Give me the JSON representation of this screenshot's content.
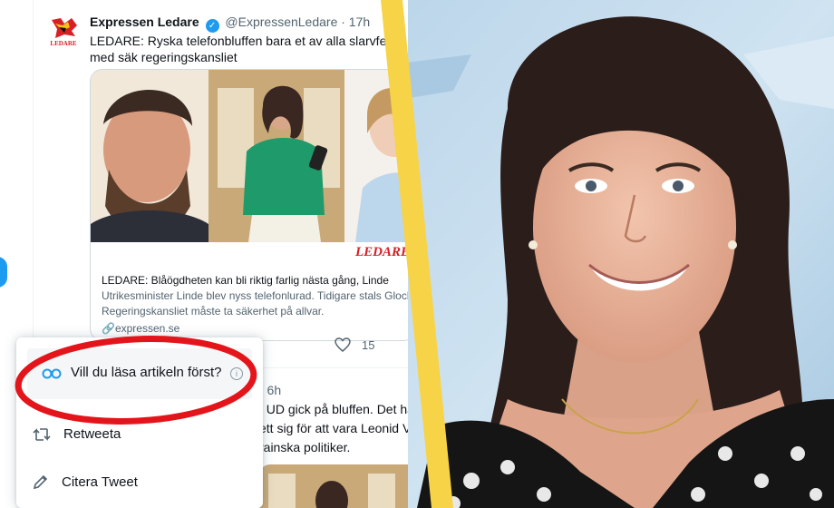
{
  "tweet": {
    "author_name": "Expressen Ledare",
    "handle_time": "@ExpressenLedare · 17h",
    "text": "LEDARE: Ryska telefonbluffen bara et av alla slarvfel med säk regeringskansliet",
    "verified_mark": "✓",
    "card": {
      "watermark": "LEDARE",
      "title": "LEDARE: Blåögdheten kan bli riktig farlig nästa gång, Linde",
      "description_line1": "Utrikesminister Linde blev nyss telefonlurad. Tidigare stals Glockp",
      "description_line2": "Regeringskansliet måste ta säkerhet på allvar.",
      "domain": "expressen.se"
    },
    "like_count": "15"
  },
  "tweet2": {
    "time": "· 6h",
    "line1": "t UD gick på bluffen. Det ha",
    "line2": "ett sig för att vara Leonid Vo",
    "line3": "rainska politiker."
  },
  "menu": {
    "read_first": "Vill du läsa artikeln först?",
    "retweet": "Retweeta",
    "quote": "Citera Tweet",
    "info_glyph": "i"
  },
  "colors": {
    "twitter_blue": "#1d9bf0",
    "stripe_yellow": "#f7d348",
    "ring_red": "#e4141b"
  }
}
